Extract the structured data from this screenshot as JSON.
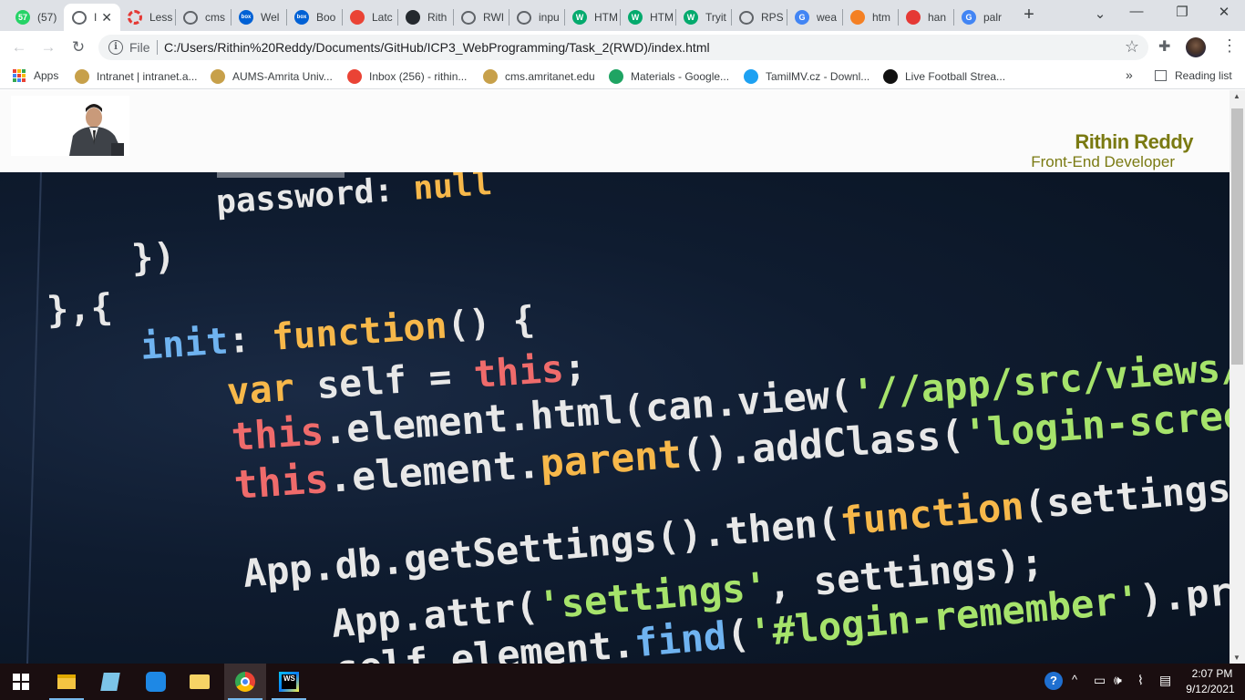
{
  "tabs": [
    {
      "title": "(57)",
      "favicon": "whatsapp-icon",
      "color": "#25d366",
      "badge": "57"
    },
    {
      "title": "I",
      "favicon": "globe-icon",
      "color": "#5f6368",
      "active": true
    },
    {
      "title": "Less",
      "favicon": "lifering-icon",
      "color": "#e53935"
    },
    {
      "title": "cms",
      "favicon": "globe-icon",
      "color": "#5f6368"
    },
    {
      "title": "Wel",
      "favicon": "box-icon",
      "color": "#0061d5",
      "badge": "box"
    },
    {
      "title": "Boo",
      "favicon": "box-icon",
      "color": "#0061d5",
      "badge": "box"
    },
    {
      "title": "Latc",
      "favicon": "latch-icon",
      "color": "#ea4335"
    },
    {
      "title": "Rith",
      "favicon": "github-icon",
      "color": "#24292e"
    },
    {
      "title": "RWI",
      "favicon": "globe-icon",
      "color": "#5f6368"
    },
    {
      "title": "inpu",
      "favicon": "globe-icon",
      "color": "#5f6368"
    },
    {
      "title": "HTM",
      "favicon": "w3schools-icon",
      "color": "#04aa6d",
      "badge": "W"
    },
    {
      "title": "HTM",
      "favicon": "w3schools-icon",
      "color": "#04aa6d",
      "badge": "W"
    },
    {
      "title": "Tryit",
      "favicon": "w3schools-icon",
      "color": "#04aa6d",
      "badge": "W"
    },
    {
      "title": "RPS",
      "favicon": "globe-icon",
      "color": "#5f6368"
    },
    {
      "title": "wea",
      "favicon": "google-icon",
      "color": "#4285f4",
      "badge": "G"
    },
    {
      "title": "htm",
      "favicon": "stackoverflow-icon",
      "color": "#f48024"
    },
    {
      "title": "han",
      "favicon": "app-icon",
      "color": "#e53935"
    },
    {
      "title": "palr",
      "favicon": "google-icon",
      "color": "#4285f4",
      "badge": "G"
    }
  ],
  "window": {
    "minimize": "—",
    "maximize": "❐",
    "close": "✕",
    "newtab": "+",
    "tab_search": "⌄"
  },
  "toolbar": {
    "back": "←",
    "forward": "→",
    "reload": "↻",
    "info": "i",
    "file_label": "File",
    "url": "C:/Users/Rithin%20Reddy/Documents/GitHub/ICP3_WebProgramming/Task_2(RWD)/index.html",
    "star": "☆",
    "extensions": "✚",
    "menu": "⋮"
  },
  "bookmarks": [
    {
      "label": "Apps",
      "icon": "apps-grid-icon"
    },
    {
      "label": "Intranet | intranet.a...",
      "icon": "amrita-icon",
      "color": "#c7a04a"
    },
    {
      "label": "AUMS-Amrita Univ...",
      "icon": "amrita-icon",
      "color": "#c7a04a"
    },
    {
      "label": "Inbox (256) - rithin...",
      "icon": "gmail-icon",
      "color": "#ea4335"
    },
    {
      "label": "cms.amritanet.edu",
      "icon": "amrita-icon",
      "color": "#c7a04a"
    },
    {
      "label": "Materials - Google...",
      "icon": "drive-icon",
      "color": "#1fa463"
    },
    {
      "label": "TamilMV.cz - Downl...",
      "icon": "tamilmv-icon",
      "color": "#1da1f2"
    },
    {
      "label": "Live Football Strea...",
      "icon": "football-icon",
      "color": "#111111"
    }
  ],
  "bookmarks_overflow": "»",
  "reading_list": "Reading list",
  "site": {
    "name": "Rithin Reddy",
    "role": "Front-End Developer",
    "brand_color": "#7a7a12"
  },
  "hero_code": [
    {
      "tokens": [
        {
          "t": "password",
          "c": "#e8e8e8"
        },
        {
          "t": ": ",
          "c": "#e8e8e8"
        },
        {
          "t": "null",
          "c": "#f7b84a"
        }
      ]
    },
    {
      "tokens": [
        {
          "t": "})",
          "c": "#e8e8e8"
        }
      ]
    },
    {
      "tokens": [
        {
          "t": "},{",
          "c": "#e8e8e8"
        }
      ]
    },
    {
      "tokens": [
        {
          "t": "init",
          "c": "#6fb3f0"
        },
        {
          "t": ": ",
          "c": "#e8e8e8"
        },
        {
          "t": "function",
          "c": "#f7b84a"
        },
        {
          "t": "() {",
          "c": "#e8e8e8"
        }
      ]
    },
    {
      "tokens": [
        {
          "t": "var ",
          "c": "#f7b84a"
        },
        {
          "t": "self = ",
          "c": "#e8e8e8"
        },
        {
          "t": "this",
          "c": "#ef6b6b"
        },
        {
          "t": ";",
          "c": "#e8e8e8"
        }
      ]
    },
    {
      "tokens": [
        {
          "t": "this",
          "c": "#ef6b6b"
        },
        {
          "t": ".element.html(can.view(",
          "c": "#e8e8e8"
        },
        {
          "t": "'//app/src/views/signi",
          "c": "#a6e36b"
        }
      ]
    },
    {
      "tokens": [
        {
          "t": "this",
          "c": "#ef6b6b"
        },
        {
          "t": ".element.",
          "c": "#e8e8e8"
        },
        {
          "t": "parent",
          "c": "#f7b84a"
        },
        {
          "t": "().addClass(",
          "c": "#e8e8e8"
        },
        {
          "t": "'login-screen'",
          "c": "#a6e36b"
        },
        {
          "t": ");",
          "c": "#e8e8e8"
        }
      ]
    },
    {
      "tokens": [
        {
          "t": "App.db.getSettings().then(",
          "c": "#e8e8e8"
        },
        {
          "t": "function",
          "c": "#f7b84a"
        },
        {
          "t": "(settings) {",
          "c": "#e8e8e8"
        }
      ]
    },
    {
      "tokens": [
        {
          "t": "App.attr(",
          "c": "#e8e8e8"
        },
        {
          "t": "'settings'",
          "c": "#a6e36b"
        },
        {
          "t": ", settings);",
          "c": "#e8e8e8"
        }
      ]
    },
    {
      "tokens": [
        {
          "t": "self.element.",
          "c": "#e8e8e8"
        },
        {
          "t": "find",
          "c": "#6fb3f0"
        },
        {
          "t": "(",
          "c": "#e8e8e8"
        },
        {
          "t": "'#login-remember'",
          "c": "#a6e36b"
        },
        {
          "t": ").prop('c",
          "c": "#e8e8e8"
        }
      ]
    }
  ],
  "taskbar": {
    "apps": [
      {
        "name": "start-icon"
      },
      {
        "name": "file-explorer-icon"
      },
      {
        "name": "notepad-icon"
      },
      {
        "name": "sync-app-icon"
      },
      {
        "name": "folder-icon"
      },
      {
        "name": "chrome-icon",
        "active": true
      },
      {
        "name": "webstorm-icon",
        "label": "WS"
      }
    ],
    "tray": {
      "help": "?",
      "chevron": "^",
      "battery": "▭",
      "volume": "🕪",
      "wifi": "⌇",
      "notifications": "▤"
    },
    "clock": {
      "time": "2:07 PM",
      "date": "9/12/2021"
    }
  }
}
